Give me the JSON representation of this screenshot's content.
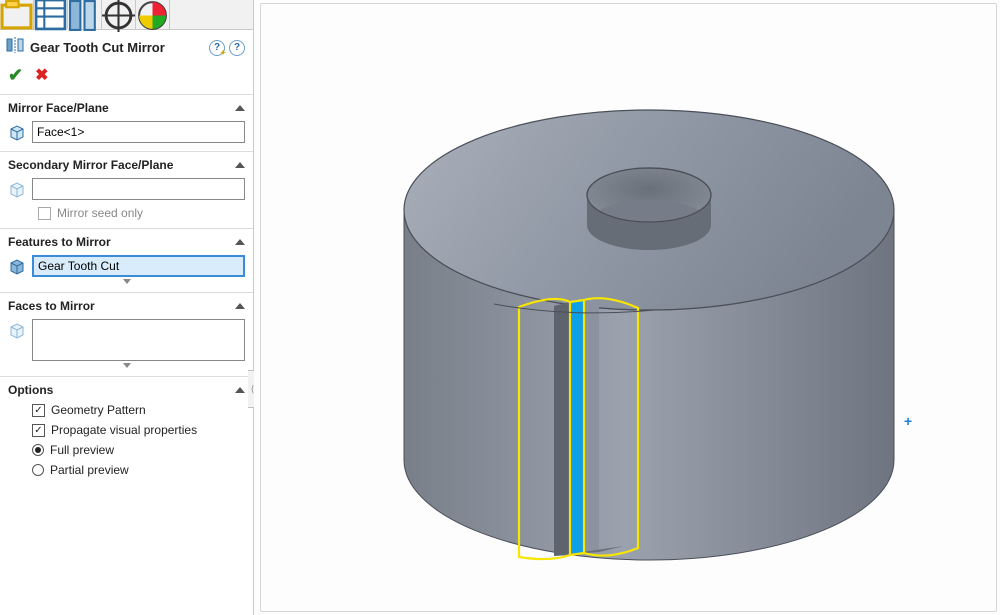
{
  "header": {
    "title": "Gear Tooth Cut Mirror"
  },
  "sections": {
    "mirrorFacePlane": {
      "title": "Mirror Face/Plane",
      "value": "Face<1>"
    },
    "secondaryMirror": {
      "title": "Secondary Mirror Face/Plane",
      "value": "",
      "mirrorSeedOnly": {
        "label": "Mirror seed only",
        "checked": false
      }
    },
    "featuresToMirror": {
      "title": "Features to Mirror",
      "value": "Gear Tooth Cut"
    },
    "facesToMirror": {
      "title": "Faces to Mirror",
      "value": ""
    },
    "options": {
      "title": "Options",
      "geometryPattern": {
        "label": "Geometry Pattern",
        "checked": true
      },
      "propagateVisual": {
        "label": "Propagate visual properties",
        "checked": true
      },
      "previewFull": {
        "label": "Full preview",
        "selected": true
      },
      "previewPartial": {
        "label": "Partial preview",
        "selected": false
      }
    }
  },
  "icons": {
    "tab1": "feature-manager-icon",
    "tab2": "property-manager-icon",
    "tab3": "config-manager-icon",
    "tab4": "dimx-manager-icon",
    "tab5": "appearance-manager-icon",
    "mirror": "mirror-feature-icon",
    "ok": "ok-check-icon",
    "cancel": "cancel-x-icon"
  }
}
